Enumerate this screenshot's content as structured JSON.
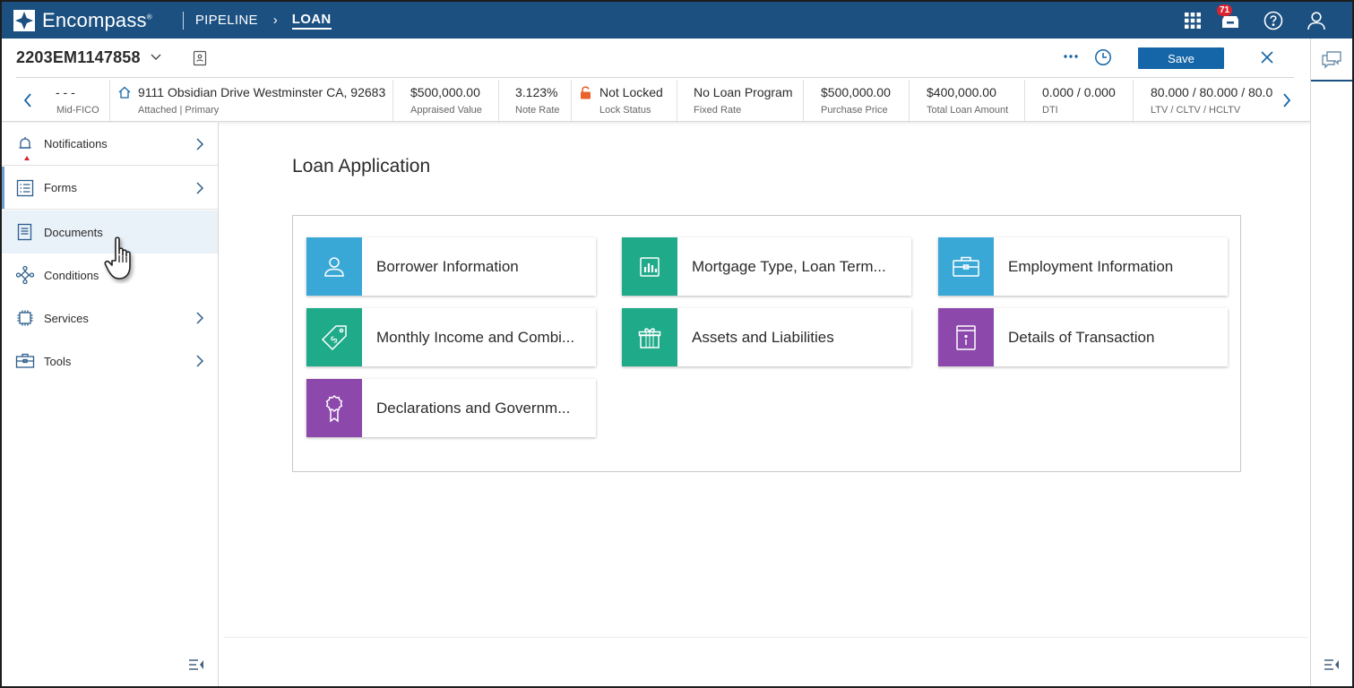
{
  "app": {
    "name": "Encompass",
    "trademark": "®",
    "brand_color": "#1b5081"
  },
  "nav": {
    "pipeline_label": "PIPELINE",
    "separator": "›",
    "loan_label": "LOAN"
  },
  "topbar": {
    "icons": [
      "apps-grid-icon",
      "inbox-tray-icon",
      "help-icon",
      "user-icon"
    ],
    "inbox_badge": "71"
  },
  "loan": {
    "number": "2203EM1147858",
    "save_label": "Save",
    "accent_color": "#1566a8"
  },
  "summary": {
    "items": [
      {
        "value": "- - -",
        "label": "Mid-FICO"
      },
      {
        "value": "9111 Obsidian Drive Westminster CA, 92683",
        "label": "Attached | Primary"
      },
      {
        "value": "$500,000.00",
        "label": "Appraised Value"
      },
      {
        "value": "3.123%",
        "label": "Note Rate"
      },
      {
        "value": "Not Locked",
        "label": "Lock Status"
      },
      {
        "value": "No Loan Program",
        "label": "Fixed Rate"
      },
      {
        "value": "$500,000.00",
        "label": "Purchase Price"
      },
      {
        "value": "$400,000.00",
        "label": "Total Loan Amount"
      },
      {
        "value": "0.000 / 0.000",
        "label": "DTI"
      },
      {
        "value": "80.000 / 80.000 / 80.0",
        "label": "LTV / CLTV / HCLTV"
      }
    ]
  },
  "sidebar": {
    "items": [
      {
        "label": "Notifications",
        "icon": "bell-icon"
      },
      {
        "label": "Forms",
        "icon": "form-list-icon"
      },
      {
        "label": "Documents",
        "icon": "document-icon"
      },
      {
        "label": "Conditions",
        "icon": "conditions-network-icon"
      },
      {
        "label": "Services",
        "icon": "chip-icon"
      },
      {
        "label": "Tools",
        "icon": "toolbox-icon"
      }
    ]
  },
  "main": {
    "title": "Loan Application",
    "tiles": [
      {
        "label": "Borrower Information",
        "color": "#3aa8d6",
        "icon": "person-icon"
      },
      {
        "label": "Mortgage Type, Loan Term...",
        "color": "#1faa8a",
        "icon": "bar-chart-icon"
      },
      {
        "label": "Employment Information",
        "color": "#3aa8d6",
        "icon": "briefcase-icon"
      },
      {
        "label": "Monthly Income and Combi...",
        "color": "#1faa8a",
        "icon": "price-tag-icon"
      },
      {
        "label": "Assets and Liabilities",
        "color": "#1faa8a",
        "icon": "gift-icon"
      },
      {
        "label": "Details of Transaction",
        "color": "#8d48ac",
        "icon": "info-document-icon"
      },
      {
        "label": "Declarations and Governm...",
        "color": "#8d48ac",
        "icon": "award-ribbon-icon"
      }
    ]
  }
}
